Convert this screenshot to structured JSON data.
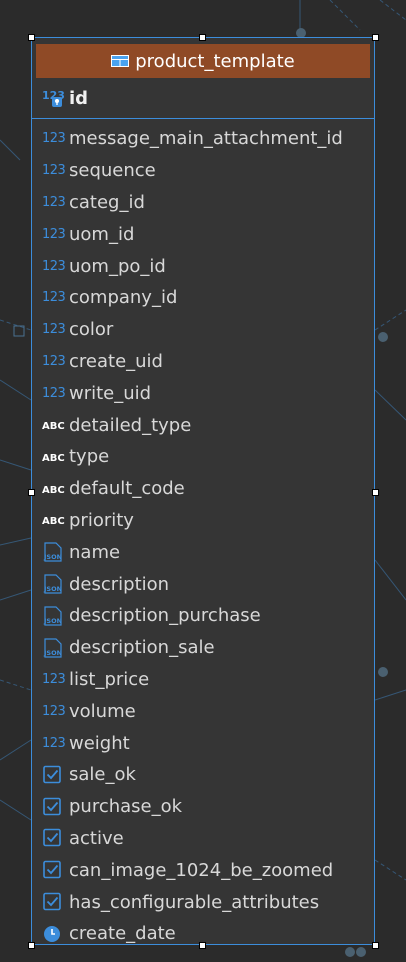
{
  "table": {
    "name": "product_template",
    "primary_key": {
      "icon": "number-key-icon",
      "label": "id"
    },
    "columns": [
      {
        "icon": "number-icon",
        "label": "message_main_attachment_id"
      },
      {
        "icon": "number-icon",
        "label": "sequence"
      },
      {
        "icon": "number-icon",
        "label": "categ_id"
      },
      {
        "icon": "number-icon",
        "label": "uom_id"
      },
      {
        "icon": "number-icon",
        "label": "uom_po_id"
      },
      {
        "icon": "number-icon",
        "label": "company_id"
      },
      {
        "icon": "number-icon",
        "label": "color"
      },
      {
        "icon": "number-icon",
        "label": "create_uid"
      },
      {
        "icon": "number-icon",
        "label": "write_uid"
      },
      {
        "icon": "text-icon",
        "label": "detailed_type"
      },
      {
        "icon": "text-icon",
        "label": "type"
      },
      {
        "icon": "text-icon",
        "label": "default_code"
      },
      {
        "icon": "text-icon",
        "label": "priority"
      },
      {
        "icon": "json-icon",
        "label": "name"
      },
      {
        "icon": "json-icon",
        "label": "description"
      },
      {
        "icon": "json-icon",
        "label": "description_purchase"
      },
      {
        "icon": "json-icon",
        "label": "description_sale"
      },
      {
        "icon": "number-icon",
        "label": "list_price"
      },
      {
        "icon": "number-icon",
        "label": "volume"
      },
      {
        "icon": "number-icon",
        "label": "weight"
      },
      {
        "icon": "checkbox-icon",
        "label": "sale_ok"
      },
      {
        "icon": "checkbox-icon",
        "label": "purchase_ok"
      },
      {
        "icon": "checkbox-icon",
        "label": "active"
      },
      {
        "icon": "checkbox-icon",
        "label": "can_image_1024_be_zoomed"
      },
      {
        "icon": "checkbox-icon",
        "label": "has_configurable_attributes"
      },
      {
        "icon": "clock-icon",
        "label": "create_date"
      }
    ]
  },
  "icon_text": {
    "number": "123",
    "abc": "ABC",
    "json": "JSON"
  },
  "colors": {
    "canvas": "#2b2b2b",
    "table_body": "#353535",
    "title_bar": "#8f4a26",
    "accent_blue": "#3c8ddb",
    "text": "#d8d8d8"
  }
}
